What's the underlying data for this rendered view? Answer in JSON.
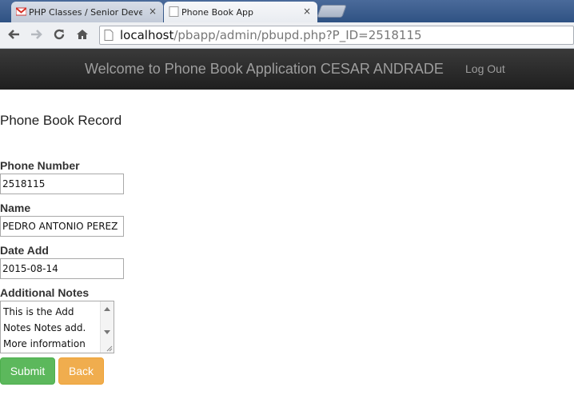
{
  "browser": {
    "tabs": [
      {
        "title": "PHP Classes / Senior Developer",
        "icon": "gmail-icon",
        "close": "×"
      },
      {
        "title": "Phone Book App",
        "icon": "page-icon",
        "close": "×"
      }
    ],
    "url": {
      "host": "localhost",
      "path": "/pbapp/admin/pbupd.php?P_ID=2518115"
    }
  },
  "navbar": {
    "brand": "Welcome to Phone Book Application CESAR ANDRADE",
    "logout": "Log Out",
    "colors": {
      "background": "#222222",
      "text": "#9d9d9d"
    }
  },
  "form": {
    "title": "Phone Book Record",
    "phone": {
      "label": "Phone Number",
      "value": "2518115"
    },
    "name": {
      "label": "Name",
      "value": "PEDRO ANTONIO PEREZ"
    },
    "date": {
      "label": "Date Add",
      "value": "2015-08-14"
    },
    "notes": {
      "label": "Additional Notes",
      "value": "This is the Add Notes Notes add. More information"
    },
    "buttons": {
      "submit": "Submit",
      "back": "Back"
    },
    "colors": {
      "submit": "#5cb85c",
      "back": "#f0ad4e"
    }
  }
}
